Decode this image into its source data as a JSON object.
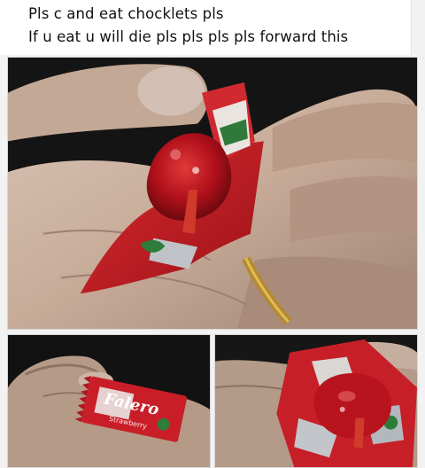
{
  "post": {
    "caption_line_1": "Pls c and eat chocklets pls",
    "caption_line_2": "If u eat u will die pls pls pls pls forward this"
  },
  "photos": {
    "main": {
      "subject": "hand holding opened candy wrapper with red candy"
    },
    "bottom_left": {
      "brand": "Falero",
      "flavor": "Strawberry"
    },
    "bottom_right": {
      "subject": "close-up of red candy on wrapper"
    }
  },
  "colors": {
    "background": "#f2f2f2",
    "caption_bg": "#ffffff",
    "text": "#111111",
    "wrapper_red": "#c8202a",
    "candy_red": "#b3121c",
    "skin": "#c9b2a2",
    "dark_bg": "#151515"
  }
}
